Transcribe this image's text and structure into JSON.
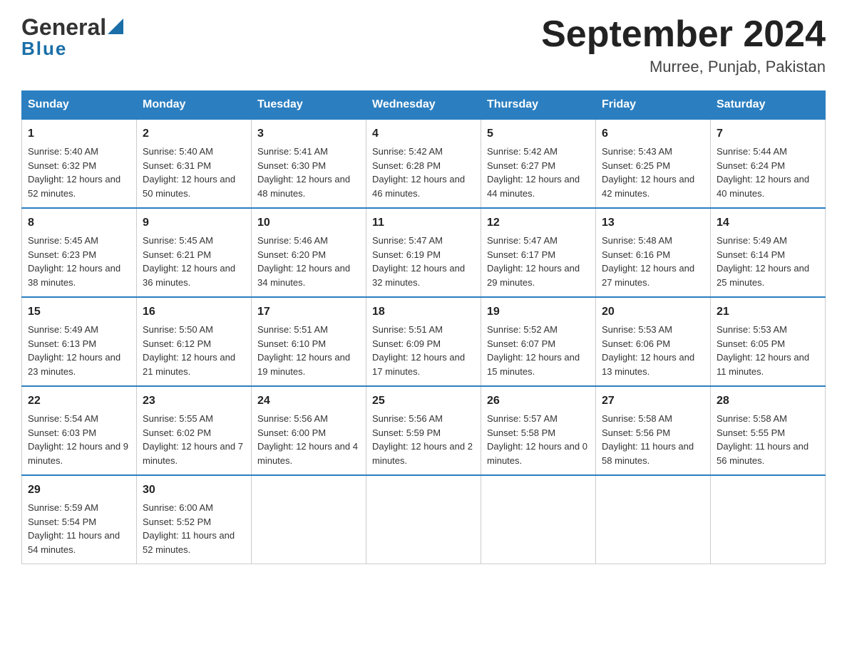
{
  "header": {
    "logo_general": "General",
    "logo_blue": "Blue",
    "title": "September 2024",
    "location": "Murree, Punjab, Pakistan"
  },
  "days_of_week": [
    "Sunday",
    "Monday",
    "Tuesday",
    "Wednesday",
    "Thursday",
    "Friday",
    "Saturday"
  ],
  "weeks": [
    [
      {
        "day": "1",
        "sunrise": "5:40 AM",
        "sunset": "6:32 PM",
        "daylight": "12 hours and 52 minutes."
      },
      {
        "day": "2",
        "sunrise": "5:40 AM",
        "sunset": "6:31 PM",
        "daylight": "12 hours and 50 minutes."
      },
      {
        "day": "3",
        "sunrise": "5:41 AM",
        "sunset": "6:30 PM",
        "daylight": "12 hours and 48 minutes."
      },
      {
        "day": "4",
        "sunrise": "5:42 AM",
        "sunset": "6:28 PM",
        "daylight": "12 hours and 46 minutes."
      },
      {
        "day": "5",
        "sunrise": "5:42 AM",
        "sunset": "6:27 PM",
        "daylight": "12 hours and 44 minutes."
      },
      {
        "day": "6",
        "sunrise": "5:43 AM",
        "sunset": "6:25 PM",
        "daylight": "12 hours and 42 minutes."
      },
      {
        "day": "7",
        "sunrise": "5:44 AM",
        "sunset": "6:24 PM",
        "daylight": "12 hours and 40 minutes."
      }
    ],
    [
      {
        "day": "8",
        "sunrise": "5:45 AM",
        "sunset": "6:23 PM",
        "daylight": "12 hours and 38 minutes."
      },
      {
        "day": "9",
        "sunrise": "5:45 AM",
        "sunset": "6:21 PM",
        "daylight": "12 hours and 36 minutes."
      },
      {
        "day": "10",
        "sunrise": "5:46 AM",
        "sunset": "6:20 PM",
        "daylight": "12 hours and 34 minutes."
      },
      {
        "day": "11",
        "sunrise": "5:47 AM",
        "sunset": "6:19 PM",
        "daylight": "12 hours and 32 minutes."
      },
      {
        "day": "12",
        "sunrise": "5:47 AM",
        "sunset": "6:17 PM",
        "daylight": "12 hours and 29 minutes."
      },
      {
        "day": "13",
        "sunrise": "5:48 AM",
        "sunset": "6:16 PM",
        "daylight": "12 hours and 27 minutes."
      },
      {
        "day": "14",
        "sunrise": "5:49 AM",
        "sunset": "6:14 PM",
        "daylight": "12 hours and 25 minutes."
      }
    ],
    [
      {
        "day": "15",
        "sunrise": "5:49 AM",
        "sunset": "6:13 PM",
        "daylight": "12 hours and 23 minutes."
      },
      {
        "day": "16",
        "sunrise": "5:50 AM",
        "sunset": "6:12 PM",
        "daylight": "12 hours and 21 minutes."
      },
      {
        "day": "17",
        "sunrise": "5:51 AM",
        "sunset": "6:10 PM",
        "daylight": "12 hours and 19 minutes."
      },
      {
        "day": "18",
        "sunrise": "5:51 AM",
        "sunset": "6:09 PM",
        "daylight": "12 hours and 17 minutes."
      },
      {
        "day": "19",
        "sunrise": "5:52 AM",
        "sunset": "6:07 PM",
        "daylight": "12 hours and 15 minutes."
      },
      {
        "day": "20",
        "sunrise": "5:53 AM",
        "sunset": "6:06 PM",
        "daylight": "12 hours and 13 minutes."
      },
      {
        "day": "21",
        "sunrise": "5:53 AM",
        "sunset": "6:05 PM",
        "daylight": "12 hours and 11 minutes."
      }
    ],
    [
      {
        "day": "22",
        "sunrise": "5:54 AM",
        "sunset": "6:03 PM",
        "daylight": "12 hours and 9 minutes."
      },
      {
        "day": "23",
        "sunrise": "5:55 AM",
        "sunset": "6:02 PM",
        "daylight": "12 hours and 7 minutes."
      },
      {
        "day": "24",
        "sunrise": "5:56 AM",
        "sunset": "6:00 PM",
        "daylight": "12 hours and 4 minutes."
      },
      {
        "day": "25",
        "sunrise": "5:56 AM",
        "sunset": "5:59 PM",
        "daylight": "12 hours and 2 minutes."
      },
      {
        "day": "26",
        "sunrise": "5:57 AM",
        "sunset": "5:58 PM",
        "daylight": "12 hours and 0 minutes."
      },
      {
        "day": "27",
        "sunrise": "5:58 AM",
        "sunset": "5:56 PM",
        "daylight": "11 hours and 58 minutes."
      },
      {
        "day": "28",
        "sunrise": "5:58 AM",
        "sunset": "5:55 PM",
        "daylight": "11 hours and 56 minutes."
      }
    ],
    [
      {
        "day": "29",
        "sunrise": "5:59 AM",
        "sunset": "5:54 PM",
        "daylight": "11 hours and 54 minutes."
      },
      {
        "day": "30",
        "sunrise": "6:00 AM",
        "sunset": "5:52 PM",
        "daylight": "11 hours and 52 minutes."
      },
      null,
      null,
      null,
      null,
      null
    ]
  ]
}
